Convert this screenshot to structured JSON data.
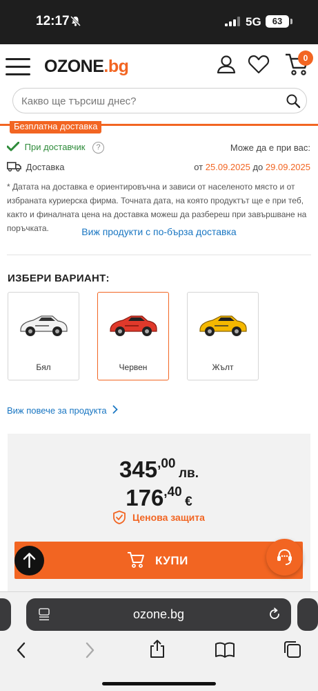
{
  "status_bar": {
    "time": "12:17",
    "network": "5G",
    "battery": "63"
  },
  "header": {
    "logo_main": "OZONE",
    "logo_domain": ".bg",
    "cart_count": "0"
  },
  "search": {
    "placeholder": "Какво ще търсиш днес?"
  },
  "delivery": {
    "free_tag": "Безплатна доставка",
    "supplier_label": "При доставчик",
    "help_mark": "?",
    "available_label": "Може да е при вас:",
    "delivery_label": "Доставка",
    "date_from_prefix": "от",
    "date_from": "25.09.2025",
    "date_to_prefix": "до",
    "date_to": "29.09.2025",
    "note": "* Датата на доставка е ориентировъчна и зависи от населеното място и от избраната куриерска фирма. Точната дата, на която продуктът ще е при теб, както и финалната цена на доставка можеш да разбереш при завършване на поръчката.",
    "faster_link": "Виж продукти с по-бърза доставка"
  },
  "variants": {
    "title": "ИЗБЕРИ ВАРИАНТ:",
    "items": [
      {
        "label": "Бял",
        "color": "#f2f2f2",
        "selected": false
      },
      {
        "label": "Червен",
        "color": "#e0392b",
        "selected": true
      },
      {
        "label": "Жълт",
        "color": "#f5b800",
        "selected": false
      }
    ]
  },
  "more_link": "Виж повече за продукта",
  "price": {
    "bgn_int": "345",
    "bgn_dec": ",00",
    "bgn_currency": "лв.",
    "eur_int": "176",
    "eur_dec": ",40",
    "eur_currency": "€",
    "protection": "Ценова защита"
  },
  "buy_button": {
    "label": "КУПИ"
  },
  "browser": {
    "url": "ozone.bg"
  },
  "colors": {
    "accent": "#f26522",
    "link": "#1976c2",
    "success": "#2e8b3a"
  }
}
